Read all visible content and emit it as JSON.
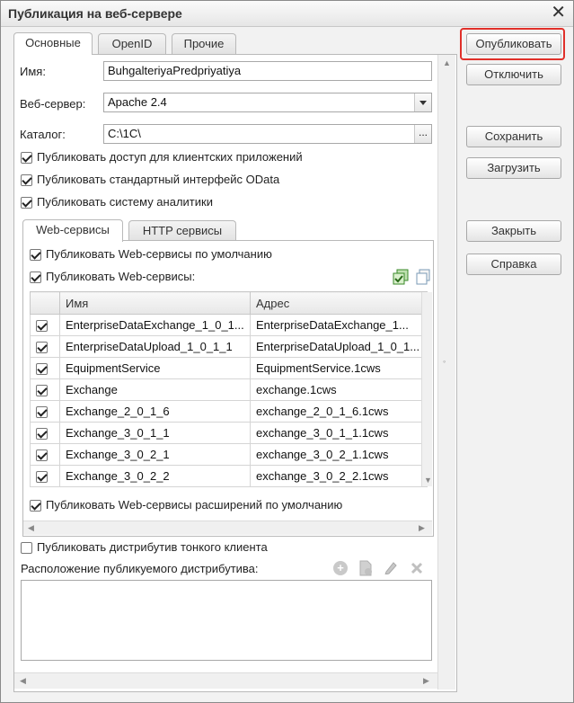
{
  "window": {
    "title": "Публикация на веб-сервере",
    "close_glyph": "✕"
  },
  "tabs": [
    "Основные",
    "OpenID",
    "Прочие"
  ],
  "fields": {
    "name_label": "Имя:",
    "name_value": "BuhgalteriyaPredpriyatiya",
    "server_label": "Веб-сервер:",
    "server_value": "Apache 2.4",
    "catalog_label": "Каталог:",
    "catalog_value": "C:\\1C\\",
    "catalog_btn": "..."
  },
  "checkboxes": {
    "client_apps": "Публиковать доступ для клиентских приложений",
    "odata": "Публиковать стандартный интерфейс OData",
    "analytics": "Публиковать систему аналитики"
  },
  "inner_tabs": [
    "Web-сервисы",
    "HTTP сервисы"
  ],
  "ws": {
    "default_label": "Публиковать Web-сервисы по умолчанию",
    "publish_label": "Публиковать Web-сервисы:",
    "columns": [
      "Имя",
      "Адрес"
    ],
    "rows": [
      {
        "name": "EnterpriseDataExchange_1_0_1...",
        "addr": "EnterpriseDataExchange_1..."
      },
      {
        "name": "EnterpriseDataUpload_1_0_1_1",
        "addr": "EnterpriseDataUpload_1_0_1..."
      },
      {
        "name": "EquipmentService",
        "addr": "EquipmentService.1cws"
      },
      {
        "name": "Exchange",
        "addr": "exchange.1cws"
      },
      {
        "name": "Exchange_2_0_1_6",
        "addr": "exchange_2_0_1_6.1cws"
      },
      {
        "name": "Exchange_3_0_1_1",
        "addr": "exchange_3_0_1_1.1cws"
      },
      {
        "name": "Exchange_3_0_2_1",
        "addr": "exchange_3_0_2_1.1cws"
      },
      {
        "name": "Exchange_3_0_2_2",
        "addr": "exchange_3_0_2_2.1cws"
      }
    ],
    "ext_label": "Публиковать Web-сервисы расширений по умолчанию"
  },
  "thin_client": {
    "checkbox_label": "Публиковать дистрибутив тонкого клиента",
    "location_label": "Расположение публикуемого дистрибутива:"
  },
  "buttons": {
    "publish": "Опубликовать",
    "disable": "Отключить",
    "save": "Сохранить",
    "load": "Загрузить",
    "close": "Закрыть",
    "help": "Справка"
  },
  "colors": {
    "highlight": "#e0302a",
    "check_icon": "#3a8a2a"
  }
}
